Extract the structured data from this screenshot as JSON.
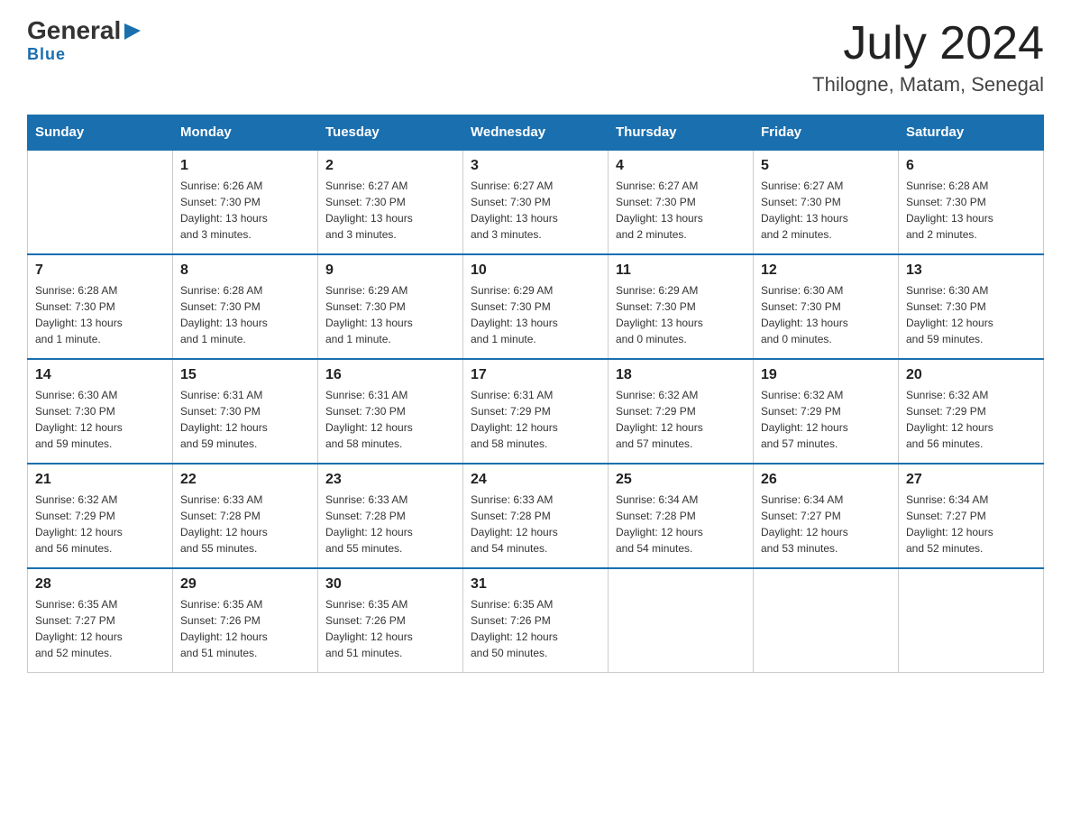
{
  "header": {
    "logo_general": "General",
    "logo_blue": "Blue",
    "title": "July 2024",
    "subtitle": "Thilogne, Matam, Senegal"
  },
  "days_of_week": [
    "Sunday",
    "Monday",
    "Tuesday",
    "Wednesday",
    "Thursday",
    "Friday",
    "Saturday"
  ],
  "weeks": [
    [
      {
        "num": "",
        "info": ""
      },
      {
        "num": "1",
        "info": "Sunrise: 6:26 AM\nSunset: 7:30 PM\nDaylight: 13 hours\nand 3 minutes."
      },
      {
        "num": "2",
        "info": "Sunrise: 6:27 AM\nSunset: 7:30 PM\nDaylight: 13 hours\nand 3 minutes."
      },
      {
        "num": "3",
        "info": "Sunrise: 6:27 AM\nSunset: 7:30 PM\nDaylight: 13 hours\nand 3 minutes."
      },
      {
        "num": "4",
        "info": "Sunrise: 6:27 AM\nSunset: 7:30 PM\nDaylight: 13 hours\nand 2 minutes."
      },
      {
        "num": "5",
        "info": "Sunrise: 6:27 AM\nSunset: 7:30 PM\nDaylight: 13 hours\nand 2 minutes."
      },
      {
        "num": "6",
        "info": "Sunrise: 6:28 AM\nSunset: 7:30 PM\nDaylight: 13 hours\nand 2 minutes."
      }
    ],
    [
      {
        "num": "7",
        "info": "Sunrise: 6:28 AM\nSunset: 7:30 PM\nDaylight: 13 hours\nand 1 minute."
      },
      {
        "num": "8",
        "info": "Sunrise: 6:28 AM\nSunset: 7:30 PM\nDaylight: 13 hours\nand 1 minute."
      },
      {
        "num": "9",
        "info": "Sunrise: 6:29 AM\nSunset: 7:30 PM\nDaylight: 13 hours\nand 1 minute."
      },
      {
        "num": "10",
        "info": "Sunrise: 6:29 AM\nSunset: 7:30 PM\nDaylight: 13 hours\nand 1 minute."
      },
      {
        "num": "11",
        "info": "Sunrise: 6:29 AM\nSunset: 7:30 PM\nDaylight: 13 hours\nand 0 minutes."
      },
      {
        "num": "12",
        "info": "Sunrise: 6:30 AM\nSunset: 7:30 PM\nDaylight: 13 hours\nand 0 minutes."
      },
      {
        "num": "13",
        "info": "Sunrise: 6:30 AM\nSunset: 7:30 PM\nDaylight: 12 hours\nand 59 minutes."
      }
    ],
    [
      {
        "num": "14",
        "info": "Sunrise: 6:30 AM\nSunset: 7:30 PM\nDaylight: 12 hours\nand 59 minutes."
      },
      {
        "num": "15",
        "info": "Sunrise: 6:31 AM\nSunset: 7:30 PM\nDaylight: 12 hours\nand 59 minutes."
      },
      {
        "num": "16",
        "info": "Sunrise: 6:31 AM\nSunset: 7:30 PM\nDaylight: 12 hours\nand 58 minutes."
      },
      {
        "num": "17",
        "info": "Sunrise: 6:31 AM\nSunset: 7:29 PM\nDaylight: 12 hours\nand 58 minutes."
      },
      {
        "num": "18",
        "info": "Sunrise: 6:32 AM\nSunset: 7:29 PM\nDaylight: 12 hours\nand 57 minutes."
      },
      {
        "num": "19",
        "info": "Sunrise: 6:32 AM\nSunset: 7:29 PM\nDaylight: 12 hours\nand 57 minutes."
      },
      {
        "num": "20",
        "info": "Sunrise: 6:32 AM\nSunset: 7:29 PM\nDaylight: 12 hours\nand 56 minutes."
      }
    ],
    [
      {
        "num": "21",
        "info": "Sunrise: 6:32 AM\nSunset: 7:29 PM\nDaylight: 12 hours\nand 56 minutes."
      },
      {
        "num": "22",
        "info": "Sunrise: 6:33 AM\nSunset: 7:28 PM\nDaylight: 12 hours\nand 55 minutes."
      },
      {
        "num": "23",
        "info": "Sunrise: 6:33 AM\nSunset: 7:28 PM\nDaylight: 12 hours\nand 55 minutes."
      },
      {
        "num": "24",
        "info": "Sunrise: 6:33 AM\nSunset: 7:28 PM\nDaylight: 12 hours\nand 54 minutes."
      },
      {
        "num": "25",
        "info": "Sunrise: 6:34 AM\nSunset: 7:28 PM\nDaylight: 12 hours\nand 54 minutes."
      },
      {
        "num": "26",
        "info": "Sunrise: 6:34 AM\nSunset: 7:27 PM\nDaylight: 12 hours\nand 53 minutes."
      },
      {
        "num": "27",
        "info": "Sunrise: 6:34 AM\nSunset: 7:27 PM\nDaylight: 12 hours\nand 52 minutes."
      }
    ],
    [
      {
        "num": "28",
        "info": "Sunrise: 6:35 AM\nSunset: 7:27 PM\nDaylight: 12 hours\nand 52 minutes."
      },
      {
        "num": "29",
        "info": "Sunrise: 6:35 AM\nSunset: 7:26 PM\nDaylight: 12 hours\nand 51 minutes."
      },
      {
        "num": "30",
        "info": "Sunrise: 6:35 AM\nSunset: 7:26 PM\nDaylight: 12 hours\nand 51 minutes."
      },
      {
        "num": "31",
        "info": "Sunrise: 6:35 AM\nSunset: 7:26 PM\nDaylight: 12 hours\nand 50 minutes."
      },
      {
        "num": "",
        "info": ""
      },
      {
        "num": "",
        "info": ""
      },
      {
        "num": "",
        "info": ""
      }
    ]
  ]
}
